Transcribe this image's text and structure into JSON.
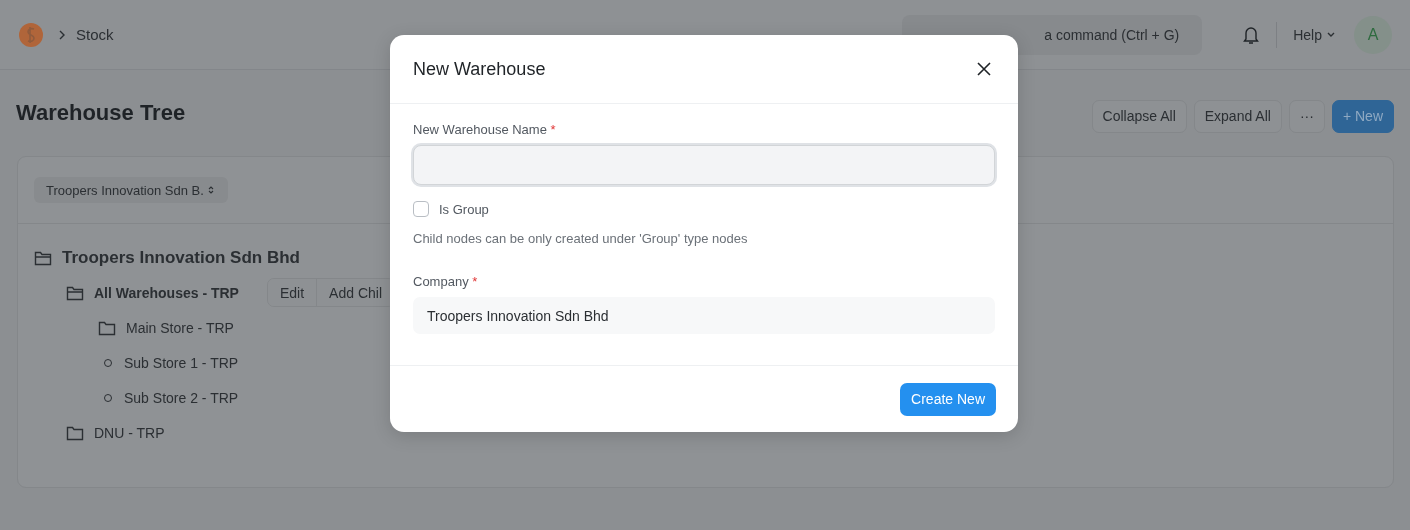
{
  "navbar": {
    "breadcrumb": "Stock",
    "search": {
      "placeholder": "a command (Ctrl + G)"
    },
    "help": "Help",
    "avatar": "A"
  },
  "page": {
    "title": "Warehouse Tree",
    "buttons": [
      {
        "label": "Collapse All",
        "kind": "default"
      },
      {
        "label": "Expand All",
        "kind": "default"
      },
      {
        "label": "···",
        "kind": "default"
      },
      {
        "label": "+ New",
        "kind": "primary"
      }
    ]
  },
  "filter": {
    "value": "Troopers Innovation Sdn B."
  },
  "tree": {
    "label": "Troopers Innovation Sdn Bhd",
    "kind": "group",
    "expanded": true,
    "children": [
      {
        "label": "All Warehouses - TRP",
        "kind": "group",
        "expanded": true,
        "selected": true,
        "actions": [
          "Edit",
          "Add Chil"
        ],
        "children": [
          {
            "label": "Main Store - TRP",
            "kind": "folder",
            "selected": false
          },
          {
            "label": "Sub Store 1 - TRP",
            "kind": "leaf",
            "selected": false
          },
          {
            "label": "Sub Store 2 - TRP",
            "kind": "leaf",
            "selected": false
          }
        ]
      },
      {
        "label": "DNU - TRP",
        "kind": "folder",
        "selected": false
      }
    ]
  },
  "dialog": {
    "title": "New Warehouse",
    "fields": [
      {
        "kind": "text",
        "label": "New Warehouse Name",
        "required_mark": "*",
        "focused": true
      },
      {
        "kind": "checkbox",
        "label": "Is Group",
        "checked": false,
        "description": "Child nodes can be only created under 'Group' type nodes"
      },
      {
        "kind": "readonly",
        "label": "Company",
        "required_mark": "*",
        "value": "Troopers Innovation Sdn Bhd"
      }
    ],
    "primary_button": "Create New"
  }
}
